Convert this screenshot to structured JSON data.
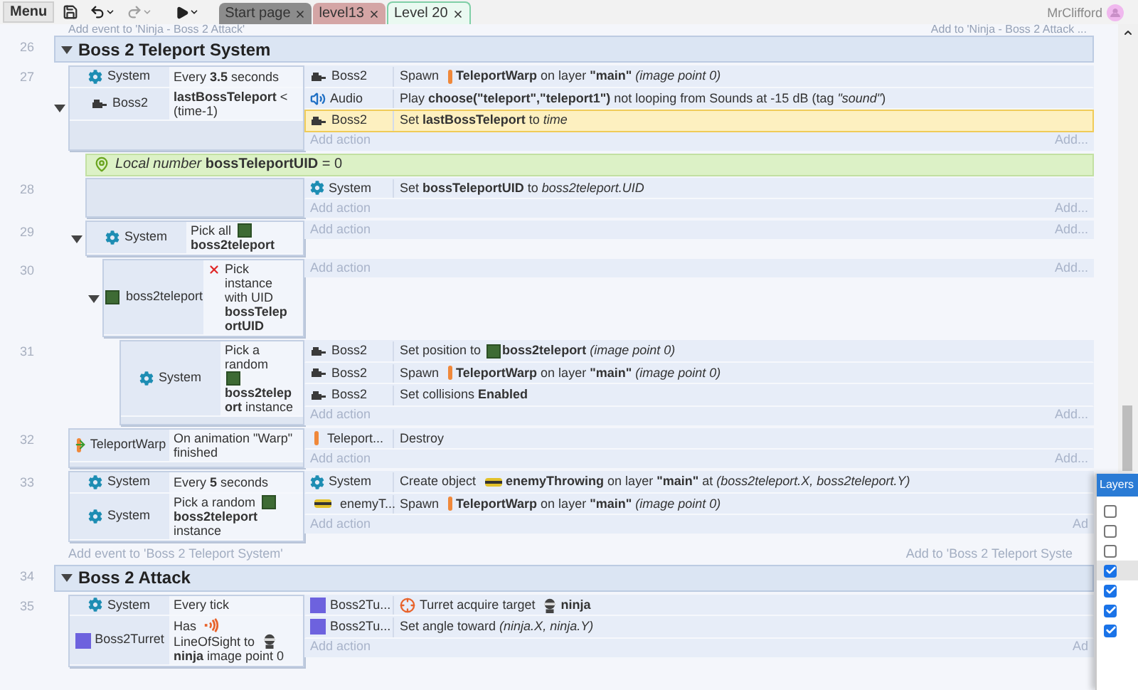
{
  "toolbar": {
    "menu": "Menu",
    "history": [
      {
        "kind": "undo",
        "disabled": false
      },
      {
        "kind": "redo",
        "disabled": true
      }
    ],
    "tabs": [
      {
        "label": "Start page",
        "color": "#8c8c8c",
        "selected": false
      },
      {
        "label": "level13",
        "color": "#d4a5a5",
        "selected": false
      },
      {
        "label": "Level 20",
        "color": "#eaf9f1",
        "selected": true
      }
    ],
    "user": {
      "name": "MrClifford"
    }
  },
  "sheet": {
    "hint": {
      "left": "Add event to 'Ninja - Boss 2 Attack'",
      "right": "Add to 'Ninja - Boss 2 Attack ..."
    },
    "groups": [
      {
        "number": "26",
        "title": "Boss 2 Teleport System",
        "expanded": true,
        "events": [
          {
            "kind": "event",
            "number": "27",
            "expanded": true,
            "conditions": [
              {
                "object": {
                  "name": "System",
                  "kind": "system"
                },
                "text": [
                  {
                    "kind": "text",
                    "text": "Every **3.5** seconds"
                  }
                ]
              },
              {
                "object": {
                  "name": "Boss2",
                  "kind": "sprite"
                },
                "text": [
                  {
                    "kind": "text",
                    "text": "**lastBossTeleport** < (time-1)"
                  }
                ]
              }
            ],
            "actions": [
              {
                "object": {
                  "name": "Boss2",
                  "kind": "sprite"
                },
                "selected": false,
                "text": [
                  {
                    "kind": "text",
                    "text": "Spawn"
                  },
                  {
                    "kind": "warp"
                  },
                  {
                    "kind": "text",
                    "text": "**TeleportWarp** on layer **\"main\"** *(image point 0)*"
                  }
                ]
              },
              {
                "object": {
                  "name": "Audio",
                  "kind": "audio"
                },
                "selected": false,
                "text": [
                  {
                    "kind": "text",
                    "text": "Play **choose(\"teleport\",\"teleport1\")** not looping from Sounds at -15 dB (tag *\"sound\"*)"
                  }
                ]
              },
              {
                "object": {
                  "name": "Boss2",
                  "kind": "sprite"
                },
                "selected": true,
                "text": [
                  {
                    "kind": "text",
                    "text": "Set **lastBossTeleport** to *time*"
                  }
                ]
              }
            ],
            "add_action": "Add action",
            "add": "Add...",
            "children": [
              {
                "kind": "variable",
                "text": "*Local number* **bossTeleportUID** = 0"
              },
              {
                "kind": "event",
                "number": "28",
                "actions": [
                  {
                    "object": {
                      "name": "System",
                      "kind": "system"
                    },
                    "selected": false,
                    "text": [
                      {
                        "kind": "text",
                        "text": "Set **bossTeleportUID** to *boss2teleport.UID*"
                      }
                    ]
                  }
                ],
                "add_action": "Add action",
                "add": "Add..."
              },
              {
                "kind": "event",
                "number": "29",
                "expanded": true,
                "conditions": [
                  {
                    "object": {
                      "name": "System",
                      "kind": "system"
                    },
                    "text": [
                      {
                        "kind": "text",
                        "text": "Pick all"
                      },
                      {
                        "kind": "teleporter"
                      },
                      {
                        "kind": "text",
                        "text": "**boss2teleport**"
                      }
                    ]
                  }
                ],
                "add_action": "Add action",
                "add": "Add...",
                "children": [
                  {
                    "kind": "event",
                    "number": "30",
                    "expanded": true,
                    "conditions": [
                      {
                        "object": {
                          "name": "boss2teleport",
                          "kind": "teleporter"
                        },
                        "inverted": true,
                        "text": [
                          {
                            "kind": "text",
                            "text": "Pick instance with UID **bossTeleportUID**"
                          }
                        ]
                      }
                    ],
                    "add_action": "Add action",
                    "add": "Add...",
                    "children": [
                      {
                        "kind": "event",
                        "number": "31",
                        "conditions": [
                          {
                            "object": {
                              "name": "System",
                              "kind": "system"
                            },
                            "text": [
                              {
                                "kind": "text",
                                "text": "Pick a random"
                              },
                              {
                                "kind": "teleporter"
                              },
                              {
                                "kind": "text",
                                "text": "**boss2teleport** instance"
                              }
                            ]
                          }
                        ],
                        "actions": [
                          {
                            "object": {
                              "name": "Boss2",
                              "kind": "sprite"
                            },
                            "selected": false,
                            "text": [
                              {
                                "kind": "text",
                                "text": "Set position to"
                              },
                              {
                                "kind": "teleporter"
                              },
                              {
                                "kind": "text",
                                "text": "**boss2teleport** *(image point 0)*"
                              }
                            ]
                          },
                          {
                            "object": {
                              "name": "Boss2",
                              "kind": "sprite"
                            },
                            "selected": false,
                            "text": [
                              {
                                "kind": "text",
                                "text": "Spawn"
                              },
                              {
                                "kind": "warp"
                              },
                              {
                                "kind": "text",
                                "text": "**TeleportWarp** on layer **\"main\"** *(image point 0)*"
                              }
                            ]
                          },
                          {
                            "object": {
                              "name": "Boss2",
                              "kind": "sprite"
                            },
                            "selected": false,
                            "text": [
                              {
                                "kind": "text",
                                "text": "Set collisions **Enabled**"
                              }
                            ]
                          }
                        ],
                        "add_action": "Add action",
                        "add": "Add..."
                      }
                    ]
                  }
                ]
              }
            ]
          },
          {
            "kind": "event",
            "number": "32",
            "conditions": [
              {
                "object": {
                  "name": "TeleportWarp",
                  "kind": "warp"
                },
                "trigger": true,
                "text": [
                  {
                    "kind": "text",
                    "text": "On animation \"Warp\" finished"
                  }
                ]
              }
            ],
            "actions": [
              {
                "object": {
                  "name": "Teleport...",
                  "kind": "warp"
                },
                "selected": false,
                "text": [
                  {
                    "kind": "text",
                    "text": "Destroy"
                  }
                ]
              }
            ],
            "add_action": "Add action",
            "add": "Add..."
          },
          {
            "kind": "event",
            "number": "33",
            "conditions": [
              {
                "object": {
                  "name": "System",
                  "kind": "system"
                },
                "text": [
                  {
                    "kind": "text",
                    "text": "Every **5** seconds"
                  }
                ]
              },
              {
                "object": {
                  "name": "System",
                  "kind": "system"
                },
                "text": [
                  {
                    "kind": "text",
                    "text": "Pick a random"
                  },
                  {
                    "kind": "teleporter"
                  },
                  {
                    "kind": "text",
                    "text": "**boss2teleport** instance"
                  }
                ]
              }
            ],
            "actions": [
              {
                "object": {
                  "name": "System",
                  "kind": "system"
                },
                "selected": false,
                "text": [
                  {
                    "kind": "text",
                    "text": "Create object"
                  },
                  {
                    "kind": "enemy"
                  },
                  {
                    "kind": "text",
                    "text": "**enemyThrowing** on layer **\"main\"** at *(boss2teleport.X, boss2teleport.Y)*"
                  }
                ]
              },
              {
                "object": {
                  "name": "enemyT...",
                  "kind": "enemy"
                },
                "selected": false,
                "text": [
                  {
                    "kind": "text",
                    "text": "Spawn"
                  },
                  {
                    "kind": "warp"
                  },
                  {
                    "kind": "text",
                    "text": "**TeleportWarp** on layer **\"main\"** *(image point 0)*"
                  }
                ]
              }
            ],
            "add_action": "Add action",
            "add": "Ad"
          }
        ],
        "add_event": {
          "left": "Add event to 'Boss 2 Teleport System'",
          "right": "Add to 'Boss 2 Teleport Syste"
        }
      },
      {
        "number": "34",
        "title": "Boss 2 Attack",
        "expanded": true,
        "events": [
          {
            "kind": "event",
            "number": "35",
            "conditions": [
              {
                "object": {
                  "name": "System",
                  "kind": "system"
                },
                "text": [
                  {
                    "kind": "text",
                    "text": "Every tick"
                  }
                ]
              },
              {
                "object": {
                  "name": "Boss2Turret",
                  "kind": "turret"
                },
                "text": [
                  {
                    "kind": "text",
                    "text": "Has"
                  },
                  {
                    "kind": "sight"
                  },
                  {
                    "kind": "text",
                    "text": "LineOfSight to"
                  },
                  {
                    "kind": "ninja"
                  },
                  {
                    "kind": "text",
                    "text": "**ninja** image point 0"
                  }
                ]
              }
            ],
            "actions": [
              {
                "object": {
                  "name": "Boss2Tu...",
                  "kind": "turret"
                },
                "selected": false,
                "text": [
                  {
                    "kind": "target"
                  },
                  {
                    "kind": "text",
                    "text": "Turret acquire target"
                  },
                  {
                    "kind": "ninja"
                  },
                  {
                    "kind": "text",
                    "text": "**ninja**"
                  }
                ]
              },
              {
                "object": {
                  "name": "Boss2Tu...",
                  "kind": "turret"
                },
                "selected": false,
                "text": [
                  {
                    "kind": "text",
                    "text": "Set angle toward *(ninja.X, ninja.Y)*"
                  }
                ]
              }
            ],
            "add_action": "Add action",
            "add": "Ad"
          }
        ]
      }
    ]
  },
  "layers": {
    "title": "Layers",
    "items": [
      {
        "checked": false,
        "selected": false
      },
      {
        "checked": false,
        "selected": false
      },
      {
        "checked": false,
        "selected": false
      },
      {
        "checked": true,
        "selected": true
      },
      {
        "checked": true,
        "selected": false
      },
      {
        "checked": true,
        "selected": false
      },
      {
        "checked": true,
        "selected": false
      }
    ]
  }
}
